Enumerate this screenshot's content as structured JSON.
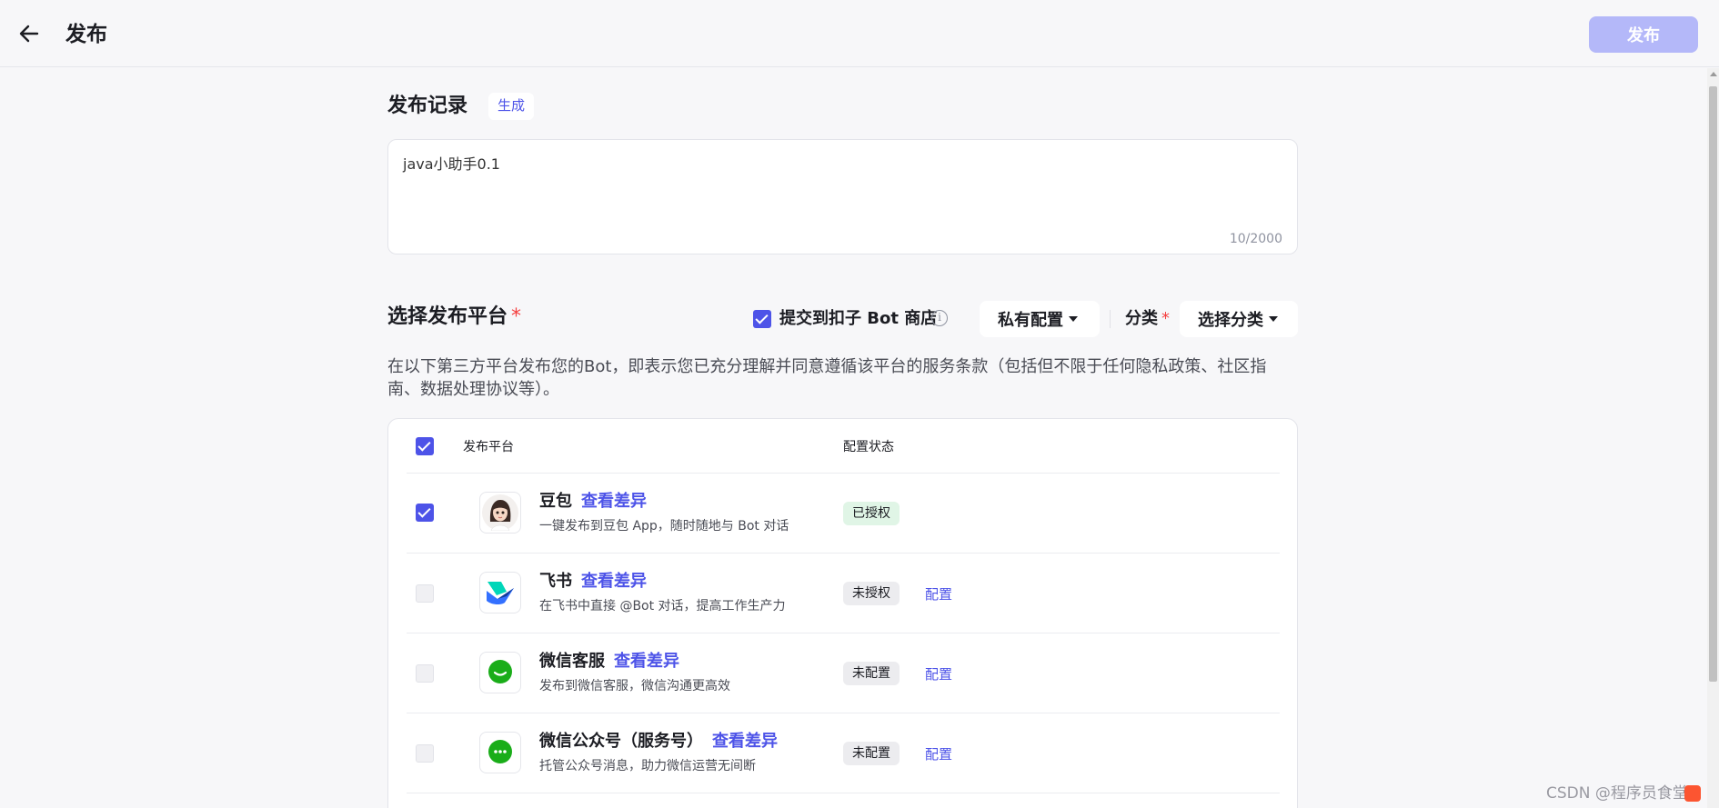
{
  "header": {
    "title": "发布",
    "publish_label": "发布"
  },
  "record": {
    "title": "发布记录",
    "generate_label": "生成",
    "value": "java小助手0.1",
    "char_count": "10/2000"
  },
  "platform": {
    "title": "选择发布平台",
    "required_mark": "*",
    "submit_store_label": "提交到扣子 Bot 商店",
    "submit_store_checked": true,
    "info_glyph": "i",
    "private_config_label": "私有配置",
    "category_label": "分类",
    "category_select_label": "选择分类",
    "description": "在以下第三方平台发布您的Bot，即表示您已充分理解并同意遵循该平台的服务条款（包括但不限于任何隐私政策、社区指南、数据处理协议等）。"
  },
  "table": {
    "header_platform": "发布平台",
    "header_status": "配置状态",
    "select_all_checked": true,
    "diff_label": "查看差异",
    "config_label": "配置",
    "rows": [
      {
        "name": "豆包",
        "desc": "一键发布到豆包 App，随时随地与 Bot 对话",
        "status": "已授权",
        "checked": true,
        "icon": "doubao-avatar-icon"
      },
      {
        "name": "飞书",
        "desc": "在飞书中直接 @Bot 对话，提高工作生产力",
        "status": "未授权",
        "checked": false,
        "icon": "feishu-icon"
      },
      {
        "name": "微信客服",
        "desc": "发布到微信客服，微信沟通更高效",
        "status": "未配置",
        "checked": false,
        "icon": "wechat-service-icon"
      },
      {
        "name": "微信公众号（服务号）",
        "desc": "托管公众号消息，助力微信运营无间断",
        "status": "未配置",
        "checked": false,
        "icon": "wechat-official-icon"
      }
    ]
  },
  "colors": {
    "accent": "#4d53e8",
    "publish_disabled": "#b4b8f9",
    "authorized_bg": "#e0f5e6",
    "wechat_green": "#1aad19"
  },
  "watermark": "CSDN @程序员食堂"
}
